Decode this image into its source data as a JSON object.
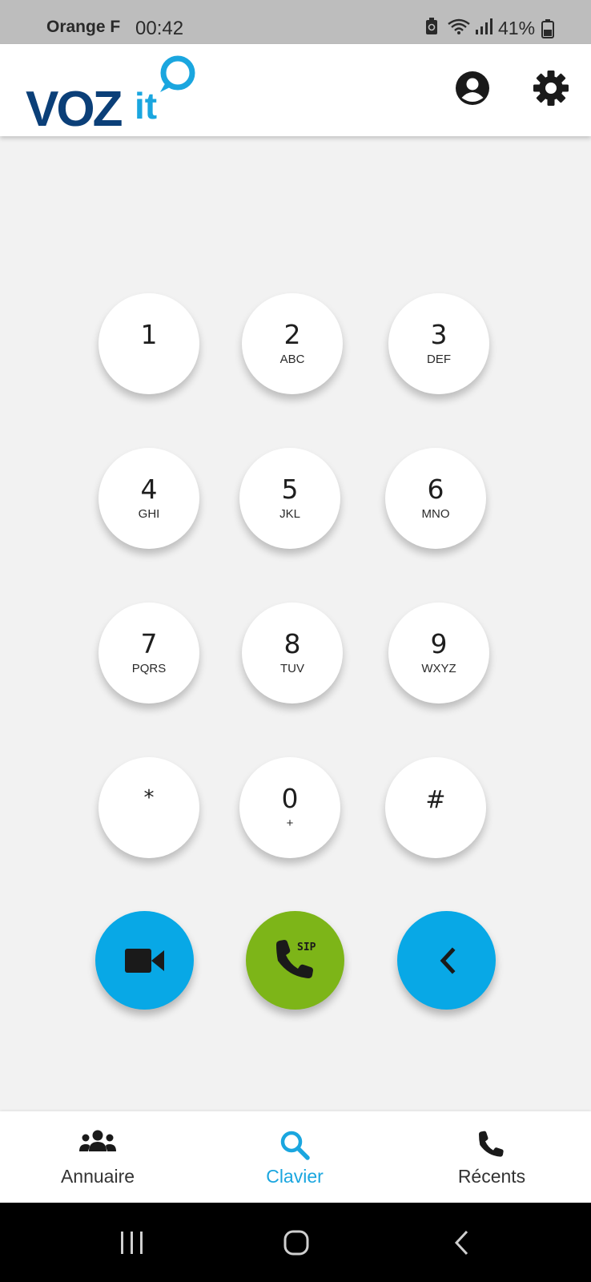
{
  "status_bar": {
    "carrier": "Orange F",
    "time": "00:42",
    "battery": "41%"
  },
  "header": {
    "logo_text": "VOZ",
    "logo_accent": "it",
    "icons": [
      "account-icon",
      "settings-gear-icon"
    ]
  },
  "keypad": {
    "keys": [
      {
        "digit": "1",
        "letters": ""
      },
      {
        "digit": "2",
        "letters": "ABC"
      },
      {
        "digit": "3",
        "letters": "DEF"
      },
      {
        "digit": "4",
        "letters": "GHI"
      },
      {
        "digit": "5",
        "letters": "JKL"
      },
      {
        "digit": "6",
        "letters": "MNO"
      },
      {
        "digit": "7",
        "letters": "PQRS"
      },
      {
        "digit": "8",
        "letters": "TUV"
      },
      {
        "digit": "9",
        "letters": "WXYZ"
      },
      {
        "digit": "*",
        "letters": ""
      },
      {
        "digit": "0",
        "letters": "+"
      },
      {
        "digit": "#",
        "letters": ""
      }
    ]
  },
  "actions": {
    "video_icon": "video-camera-icon",
    "call_badge": "SIP",
    "call_icon": "phone-sip-icon",
    "backspace_icon": "chevron-left-icon",
    "colors": {
      "blue": "#08a8e6",
      "green": "#7db518"
    }
  },
  "bottom_nav": {
    "items": [
      {
        "label": "Annuaire",
        "icon": "contacts-group-icon"
      },
      {
        "label": "Clavier",
        "icon": "search-icon",
        "active": true
      },
      {
        "label": "Récents",
        "icon": "phone-icon"
      }
    ],
    "active_color": "#1aa6df"
  },
  "system_nav": {
    "icons": [
      "recents-icon",
      "home-icon",
      "back-icon"
    ]
  }
}
